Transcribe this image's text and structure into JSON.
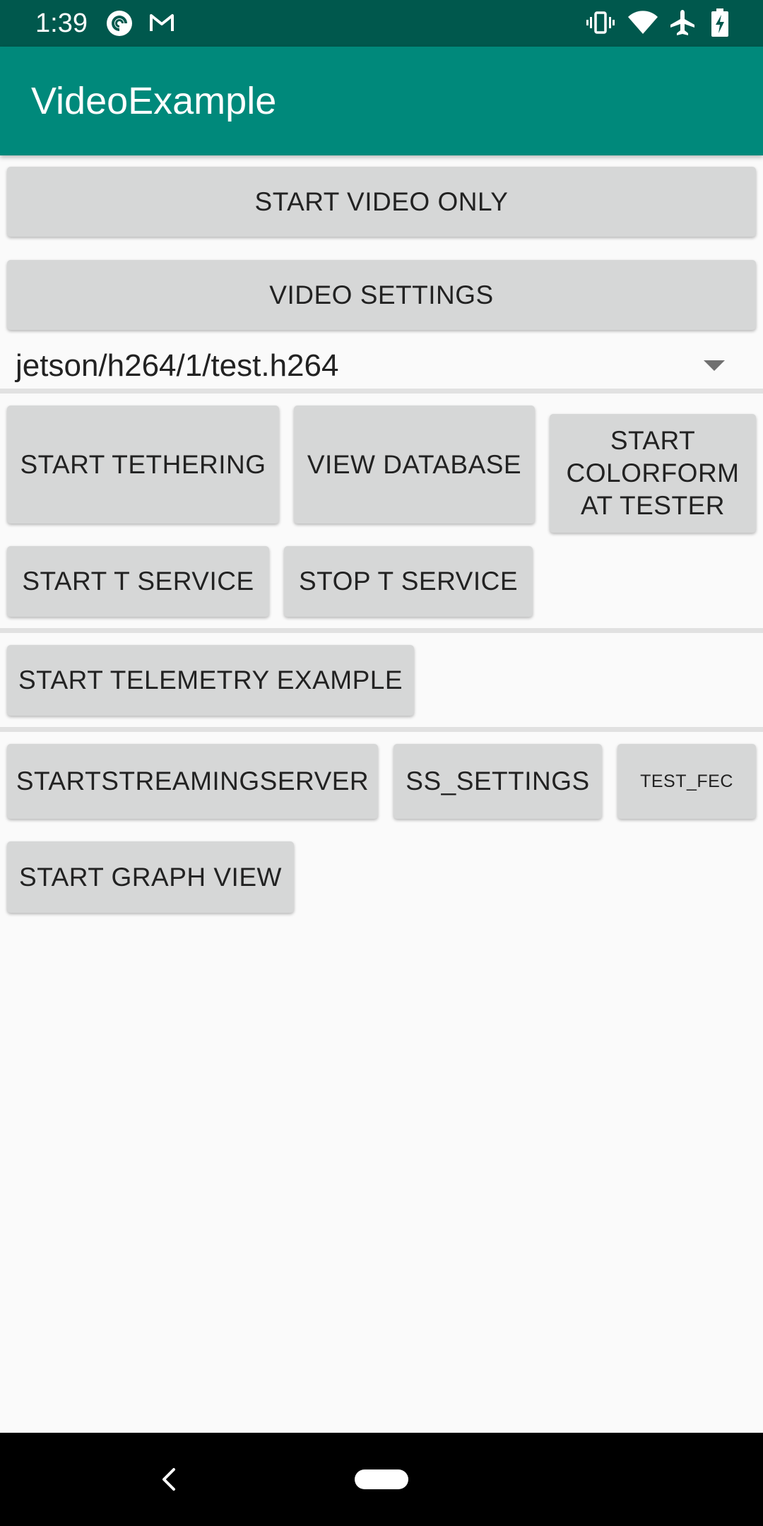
{
  "status_bar": {
    "time": "1:39",
    "left_icons": [
      "pocket-casts-icon",
      "gmail-icon"
    ],
    "right_icons": [
      "vibrate-icon",
      "wifi-icon",
      "airplane-mode-icon",
      "battery-charging-icon"
    ],
    "background": "#00584d"
  },
  "app_bar": {
    "title": "VideoExample",
    "background": "#00897b"
  },
  "buttons": {
    "start_video_only": "START VIDEO ONLY",
    "video_settings": "VIDEO SETTINGS",
    "start_tethering": "START TETHERING",
    "view_database": "VIEW DATABASE",
    "start_colorformat_tester": "START COLORFORM AT TESTER",
    "start_t_service": "START T SERVICE",
    "stop_t_service": "STOP T SERVICE",
    "start_telemetry_example": "START TELEMETRY EXAMPLE",
    "start_streaming_server": "STARTSTREAMINGSERVER",
    "ss_settings": "SS_SETTINGS",
    "test_fec": "TEST_FEC",
    "start_graph_view": "START GRAPH VIEW"
  },
  "file_spinner": {
    "selected": "jetson/h264/1/test.h264",
    "icon": "dropdown-arrow-icon"
  },
  "nav_bar": {
    "icons": [
      "back-icon",
      "home-pill-icon"
    ]
  },
  "colors": {
    "button_background": "#d6d7d7",
    "page_background": "#fafafa"
  }
}
